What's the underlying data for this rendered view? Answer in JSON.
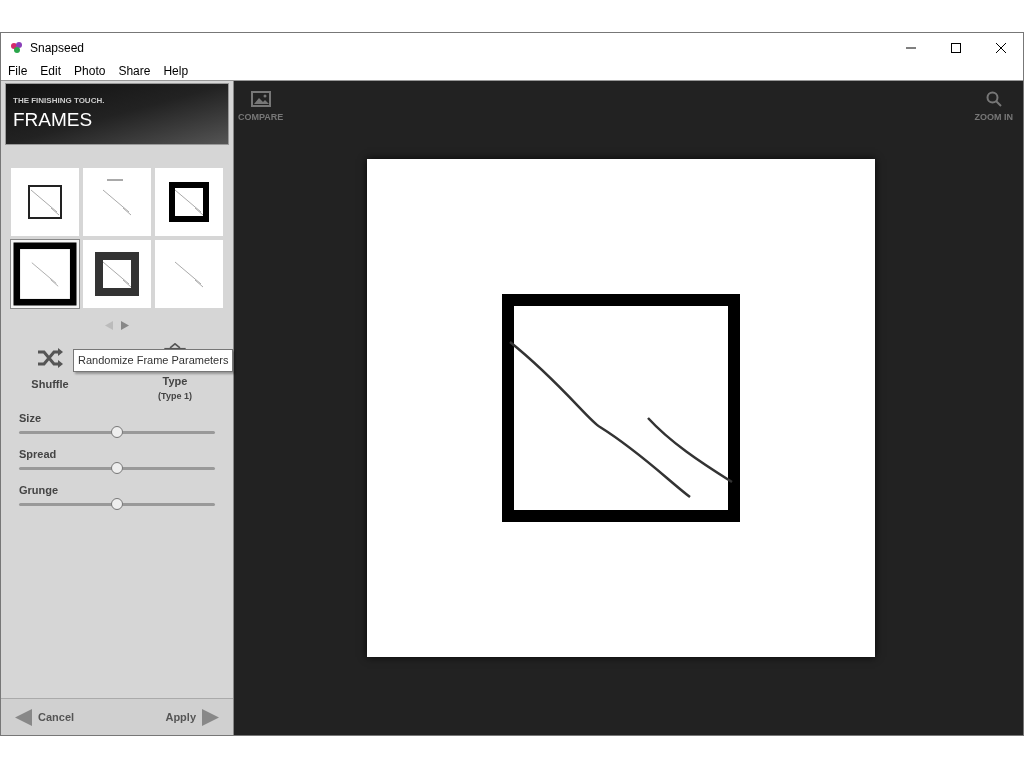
{
  "window": {
    "title": "Snapseed"
  },
  "menu": [
    "File",
    "Edit",
    "Photo",
    "Share",
    "Help"
  ],
  "panel": {
    "subtitle": "THE FINISHING TOUCH.",
    "title": "FRAMES",
    "thumbnails": [
      {
        "kind": "thin",
        "selected": false
      },
      {
        "kind": "faint",
        "selected": false
      },
      {
        "kind": "rough",
        "selected": false
      },
      {
        "kind": "heavy",
        "selected": true
      },
      {
        "kind": "vignette",
        "selected": false
      },
      {
        "kind": "none",
        "selected": false
      }
    ],
    "shuffle": {
      "label": "Shuffle"
    },
    "type": {
      "label": "Type",
      "value": "(Type 1)"
    },
    "tooltip": "Randomize Frame Parameters",
    "sliders": [
      {
        "label": "Size",
        "level": 0.5
      },
      {
        "label": "Spread",
        "level": 0.5
      },
      {
        "label": "Grunge",
        "level": 0.5
      }
    ],
    "cancel": "Cancel",
    "apply": "Apply"
  },
  "toolbar": {
    "compare": "COMPARE",
    "zoom": "ZOOM IN"
  }
}
